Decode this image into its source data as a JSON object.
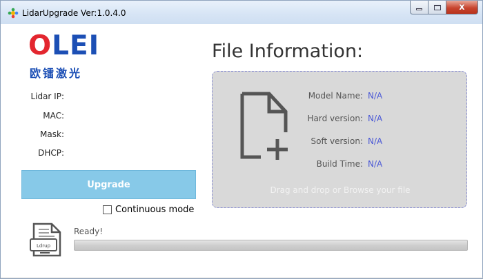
{
  "window": {
    "title": "LidarUpgrade  Ver:1.0.4.0",
    "close_glyph": "x"
  },
  "logo": {
    "main_o": "O",
    "main_rest": "LEI",
    "sub": "欧镭激光"
  },
  "device_info": {
    "lidar_ip_label": "Lidar IP:",
    "mac_label": "MAC:",
    "mask_label": "Mask:",
    "dhcp_label": "DHCP:"
  },
  "upgrade_button": {
    "label": "Upgrade"
  },
  "continuous_mode": {
    "label": "Continuous mode",
    "checked": false
  },
  "file_info": {
    "title": "File Information:",
    "fields": [
      {
        "label": "Model Name:",
        "value": "N/A"
      },
      {
        "label": "Hard version:",
        "value": "N/A"
      },
      {
        "label": "Soft version:",
        "value": "N/A"
      },
      {
        "label": "Build Time:",
        "value": "N/A"
      }
    ],
    "drop_hint": "Drag and drop or Browse your file"
  },
  "status": {
    "icon_label": "Ldrup",
    "text": "Ready!",
    "progress": 0
  },
  "colors": {
    "accent_blue": "#1c4fb5",
    "accent_red": "#e3262f",
    "value_blue": "#4a58d6",
    "button_blue": "#87c9e8",
    "dropzone_bg": "#d9d9d9"
  }
}
